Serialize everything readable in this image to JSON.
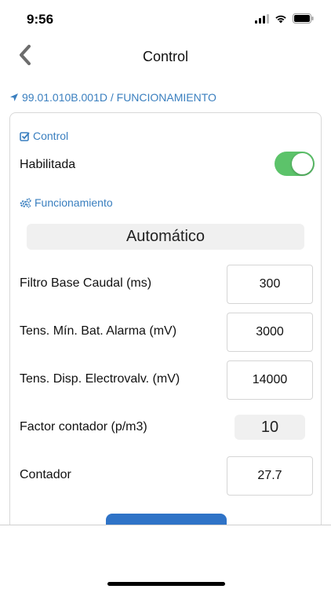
{
  "status_bar": {
    "time": "9:56"
  },
  "nav": {
    "title": "Control"
  },
  "breadcrumb": {
    "text": "99.01.010B.001D / FUNCIONAMIENTO"
  },
  "control_section": {
    "header": "Control",
    "enabled_label": "Habilitada",
    "enabled": true
  },
  "funcionamiento_section": {
    "header": "Funcionamiento",
    "mode": "Automático"
  },
  "fields": [
    {
      "label": "Filtro Base Caudal (ms)",
      "value": "300"
    },
    {
      "label": "Tens. Mín. Bat. Alarma (mV)",
      "value": "3000"
    },
    {
      "label": "Tens. Disp. Electrovalv. (mV)",
      "value": "14000"
    },
    {
      "label": "Factor contador (p/m3)",
      "value": "10"
    },
    {
      "label": "Contador",
      "value": "27.7"
    }
  ],
  "colors": {
    "accent": "#3a7fbf",
    "toggle_on": "#5cc36a",
    "button": "#2f73c7"
  },
  "icons": {
    "back": "chevron-left-icon",
    "breadcrumb": "location-arrow-icon",
    "control": "checkbox-icon",
    "funcionamiento": "gears-icon"
  }
}
